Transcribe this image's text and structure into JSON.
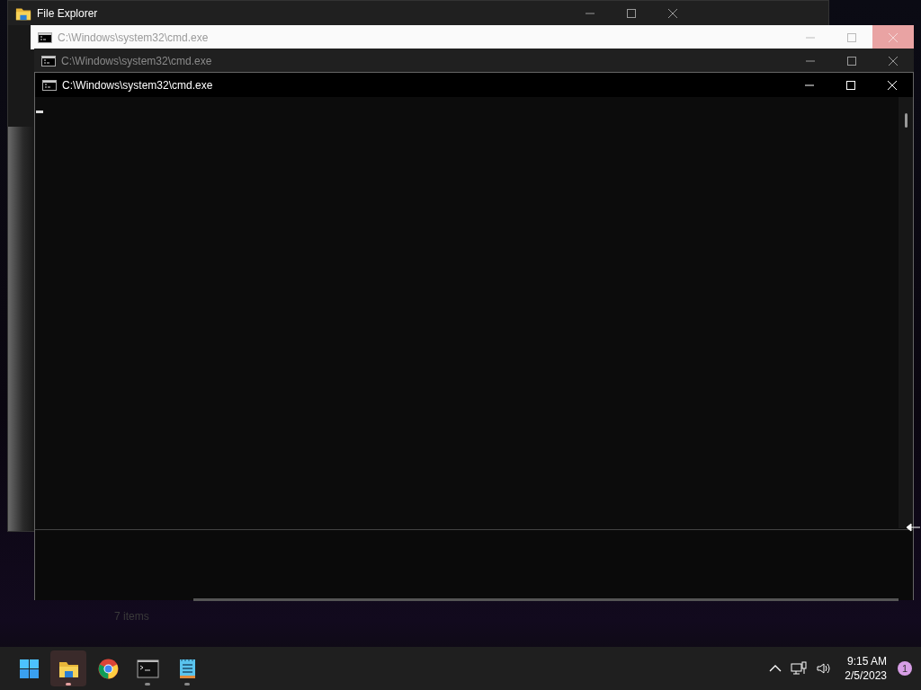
{
  "windows": [
    {
      "kind": "explorer",
      "title": "File Explorer",
      "light_title_bar": false,
      "status": "7 items"
    },
    {
      "kind": "console",
      "title": "C:\\Windows\\system32\\cmd.exe",
      "active": false,
      "light_title_bar": true,
      "close_highlighted": true
    },
    {
      "kind": "console",
      "title": "C:\\Windows\\system32\\cmd.exe",
      "active": false,
      "light_title_bar": false,
      "close_highlighted": false
    },
    {
      "kind": "console",
      "title": "C:\\Windows\\system32\\cmd.exe",
      "active": true,
      "light_title_bar": false,
      "close_highlighted": false
    }
  ],
  "taskbar": {
    "apps": [
      {
        "kind": "start",
        "selected": false,
        "running": false
      },
      {
        "kind": "folder",
        "selected": true,
        "running": true
      },
      {
        "kind": "browser",
        "selected": false,
        "running": false
      },
      {
        "kind": "terminal",
        "selected": false,
        "running": true
      },
      {
        "kind": "notepad",
        "selected": false,
        "running": true
      }
    ],
    "time": "9:15 AM",
    "date": "2/5/2023",
    "notification_count": "1"
  }
}
